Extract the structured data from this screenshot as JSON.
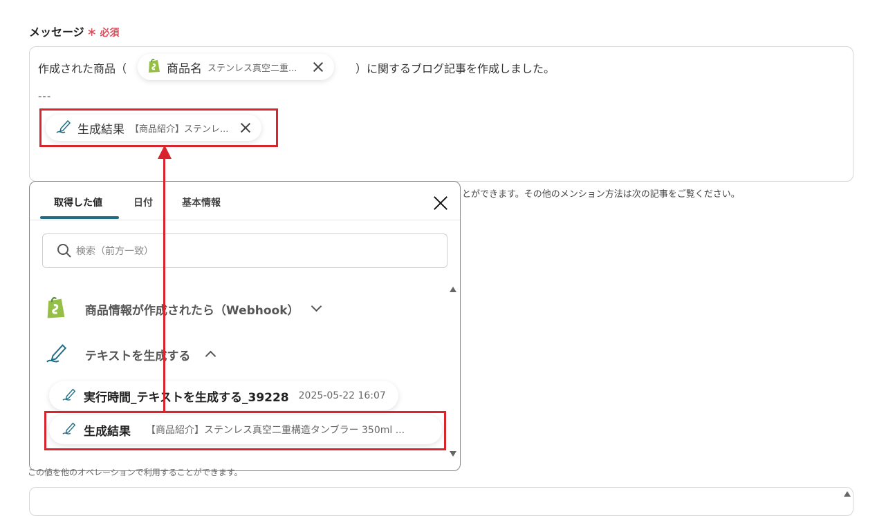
{
  "field": {
    "label": "メッセージ",
    "required_mark": "＊",
    "required_text": "必須"
  },
  "message": {
    "text_before": "作成された商品（",
    "text_after": "）に関するブログ記事を作成しました。",
    "separator": "---",
    "chip1": {
      "label": "商品名",
      "value": "ステンレス真空二重..."
    },
    "chip2": {
      "label": "生成結果",
      "value": "【商品紹介】ステンレ..."
    }
  },
  "hint_text": "とができます。その他のメンション方法は次の記事をご覧ください。",
  "bottom_hint": "この値を他のオペレーションで利用することができます。",
  "popup": {
    "tabs": [
      "取得した値",
      "日付",
      "基本情報"
    ],
    "active_tab": 0,
    "search_placeholder": "検索（前方一致）",
    "sections": [
      {
        "title": "商品情報が作成されたら（Webhook）",
        "icon": "shopify-icon",
        "expanded": false
      },
      {
        "title": "テキストを生成する",
        "icon": "ai-pen-icon",
        "expanded": true
      }
    ],
    "items": [
      {
        "label": "実行時間_テキストを生成する_39228",
        "value": "2025-05-22 16:07"
      },
      {
        "label": "生成結果",
        "value": "【商品紹介】ステンレス真空二重構造タンブラー 350ml ..."
      }
    ]
  },
  "colors": {
    "accent": "#1e6e86",
    "highlight": "#d9232d",
    "required": "#e14b5a",
    "shopify": "#95bf47"
  }
}
